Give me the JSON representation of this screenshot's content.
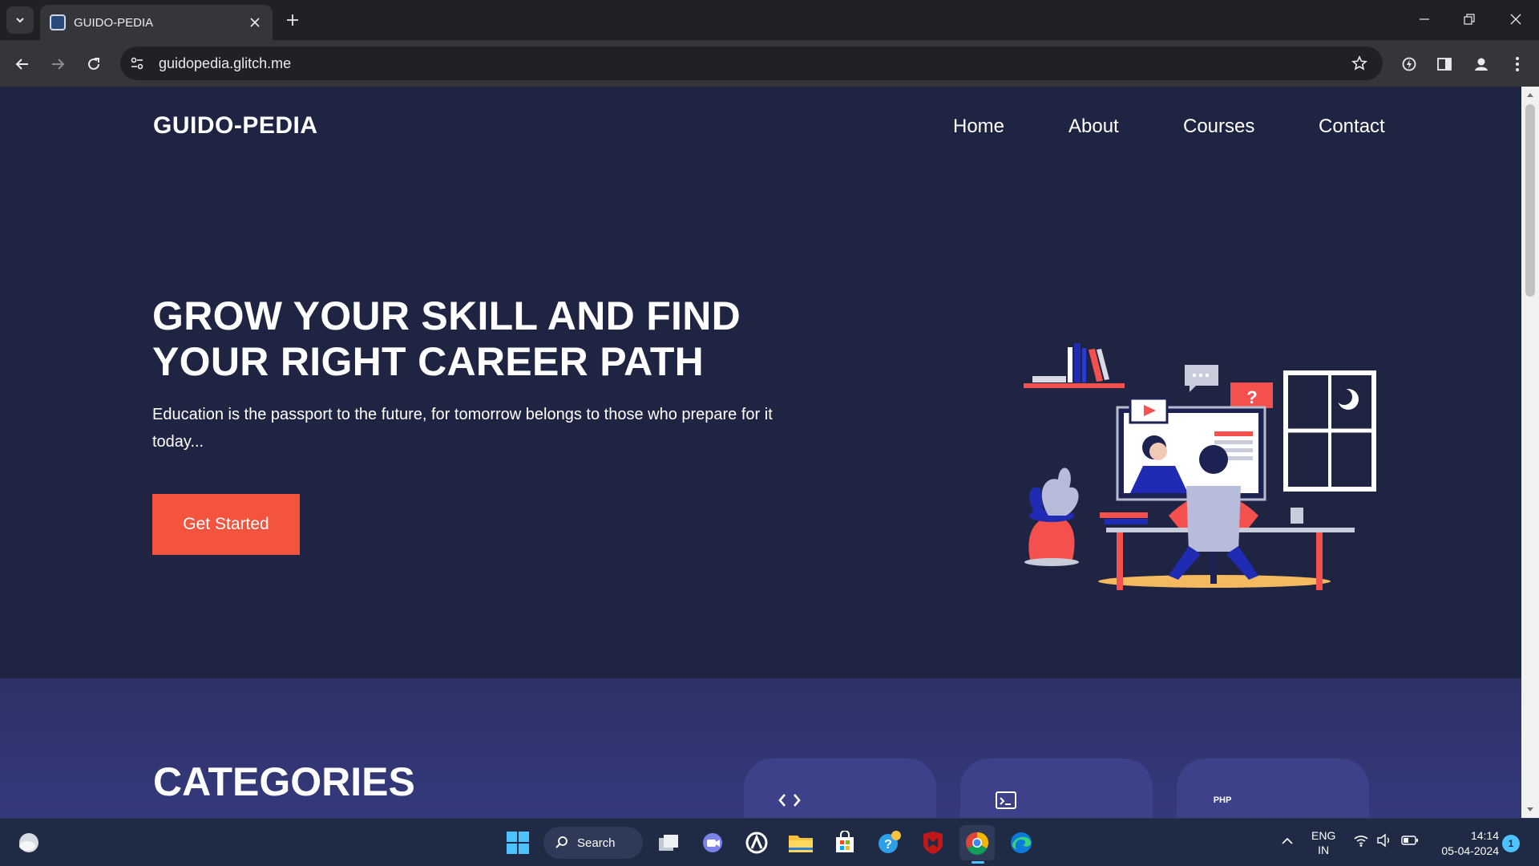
{
  "browser": {
    "tab_title": "GUIDO-PEDIA",
    "url": "guidopedia.glitch.me"
  },
  "site": {
    "logo": "GUIDO-PEDIA",
    "nav": [
      "Home",
      "About",
      "Courses",
      "Contact"
    ]
  },
  "hero": {
    "title_line1": "GROW YOUR SKILL AND FIND",
    "title_line2": "YOUR RIGHT CAREER PATH",
    "text": "Education is the passport to the future, for tomorrow belongs to those who prepare for it today...",
    "cta_label": "Get Started"
  },
  "categories": {
    "title": "CATEGORIES",
    "cards": [
      {
        "icon": "code-icon"
      },
      {
        "icon": "terminal-icon"
      },
      {
        "icon": "php-icon",
        "icon_text": "PHP"
      }
    ]
  },
  "taskbar": {
    "search_label": "Search",
    "lang_line1": "ENG",
    "lang_line2": "IN",
    "time": "14:14",
    "date": "05-04-2024",
    "notification_count": "1"
  },
  "colors": {
    "page_bg": "#1f2443",
    "accent": "#f4543e",
    "categories_bg": "#353a80"
  }
}
